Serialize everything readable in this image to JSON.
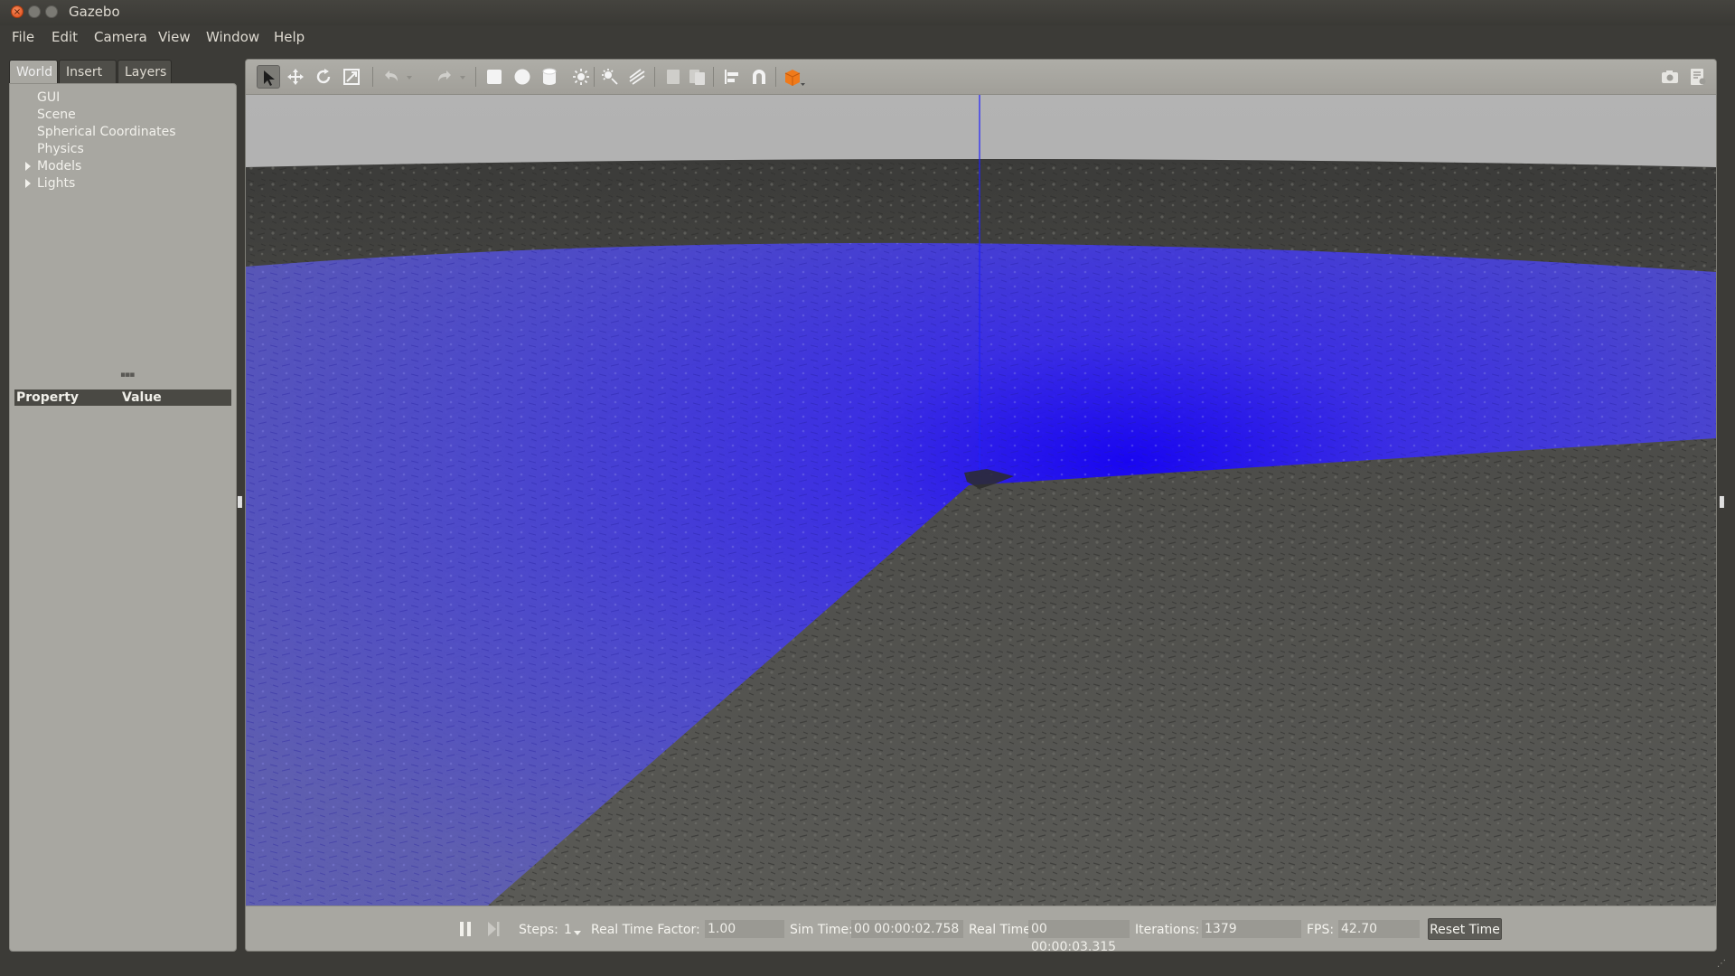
{
  "window": {
    "title": "Gazebo"
  },
  "menu": [
    "File",
    "Edit",
    "Camera",
    "View",
    "Window",
    "Help"
  ],
  "left_panel": {
    "tabs": [
      "World",
      "Insert",
      "Layers"
    ],
    "active_tab": "World",
    "tree": [
      {
        "label": "GUI",
        "expandable": false
      },
      {
        "label": "Scene",
        "expandable": false
      },
      {
        "label": "Spherical Coordinates",
        "expandable": false
      },
      {
        "label": "Physics",
        "expandable": false
      },
      {
        "label": "Models",
        "expandable": true
      },
      {
        "label": "Lights",
        "expandable": true
      }
    ],
    "property_header": {
      "property": "Property",
      "value": "Value"
    }
  },
  "toolbar": {
    "tools": [
      "select-arrow-icon",
      "translate-icon",
      "rotate-icon",
      "scale-icon",
      "undo-icon",
      "undo-dropdown-icon",
      "redo-icon",
      "redo-dropdown-icon",
      "box-icon",
      "sphere-icon",
      "cylinder-icon",
      "point-light-icon",
      "spot-light-icon",
      "directional-light-icon",
      "copy-icon",
      "paste-icon",
      "align-icon",
      "snap-icon",
      "view-angle-icon"
    ],
    "right_tools": [
      "screenshot-icon",
      "record-log-icon"
    ],
    "colors": {
      "accent_orange": "#f07a1a"
    }
  },
  "status": {
    "steps_label": "Steps:",
    "steps_value": "1",
    "rtf_label": "Real Time Factor:",
    "rtf_value": "1.00",
    "sim_time_label": "Sim Time:",
    "sim_time_value": "00 00:00:02.758",
    "real_time_label": "Real Time:",
    "real_time_value": "00 00:00:03.315",
    "iterations_label": "Iterations:",
    "iterations_value": "1379",
    "fps_label": "FPS:",
    "fps_value": "42.70",
    "reset_label": "Reset Time"
  },
  "colors": {
    "sky": "#aeaeae",
    "ground": "#4e4e4b",
    "laser": "#1a10ff",
    "blue_axis": "#2020ff"
  }
}
